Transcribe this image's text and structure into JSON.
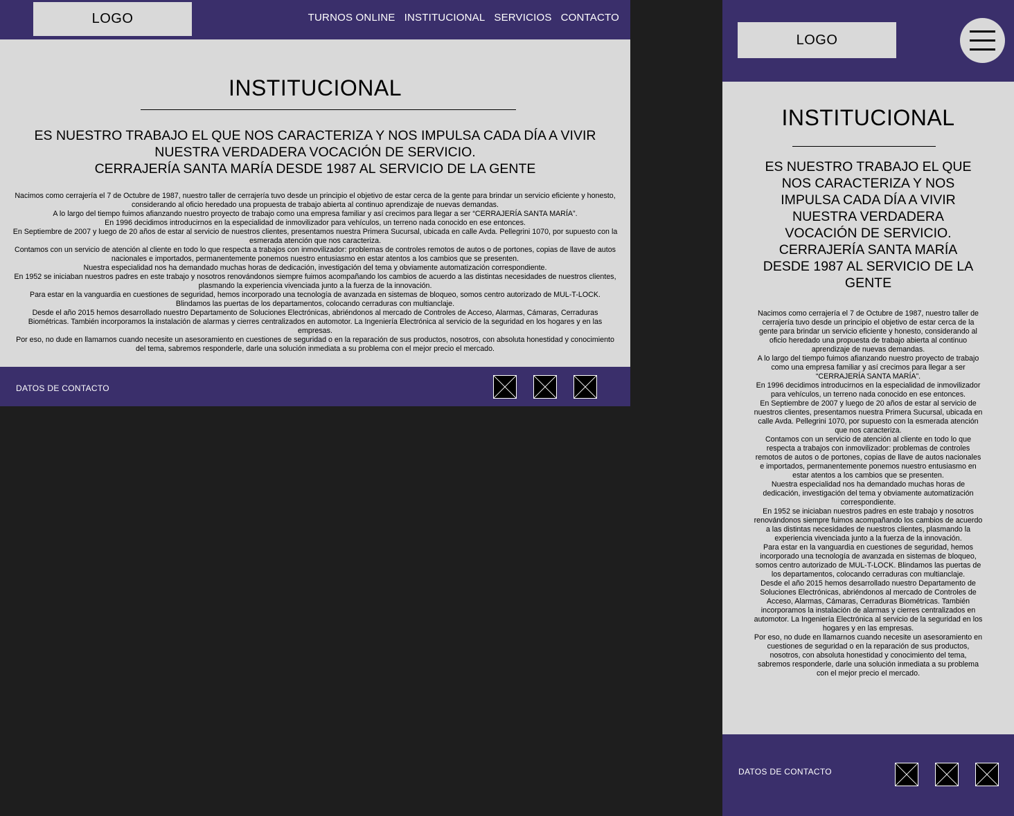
{
  "colors": {
    "header_bg": "#3a2f6b",
    "content_bg": "#d9d9d9",
    "canvas_bg": "#1e1e1e",
    "text": "#000000",
    "footer_text": "#ffffff"
  },
  "header": {
    "logo": "LOGO",
    "nav": [
      "TURNOS ONLINE",
      "INSTITUCIONAL",
      "SERVICIOS",
      "CONTACTO"
    ]
  },
  "mobile_header": {
    "logo": "LOGO",
    "menu_icon": "hamburger-icon"
  },
  "main": {
    "title": "INSTITUCIONAL",
    "subtitle": [
      "ES NUESTRO TRABAJO EL QUE NOS CARACTERIZA Y NOS IMPULSA CADA DÍA A VIVIR NUESTRA VERDADERA VOCACIÓN DE SERVICIO.",
      "CERRAJERÍA SANTA MARÍA DESDE 1987 AL SERVICIO DE LA GENTE"
    ],
    "paragraphs": [
      "Nacimos como cerrajería el 7 de Octubre de 1987, nuestro taller de cerrajería tuvo desde un principio el objetivo de estar cerca de la gente para brindar un servicio eficiente y honesto, considerando al oficio heredado una propuesta de trabajo abierta al continuo aprendizaje de nuevas demandas.",
      "A lo largo del tiempo fuimos afianzando nuestro proyecto de trabajo como una empresa familiar y así crecimos para llegar a ser “CERRAJERÍA SANTA MARÍA”.",
      "En 1996 decidimos introducirnos en la especialidad de inmovilizador para vehículos, un terreno nada conocido en ese entonces.",
      "En Septiembre de 2007 y luego de 20 años de estar al servicio de nuestros clientes, presentamos nuestra Primera Sucursal, ubicada en calle Avda. Pellegrini 1070, por supuesto con la esmerada atención que nos caracteriza.",
      "Contamos con un servicio de atención al cliente en todo lo que respecta a trabajos con inmovilizador: problemas de controles remotos de autos o de portones, copias de llave de autos nacionales e importados, permanentemente ponemos nuestro entusiasmo en estar atentos a los cambios que se presenten.",
      "Nuestra especialidad nos ha demandado muchas horas de dedicación, investigación del tema y obviamente automatización correspondiente.",
      "En 1952 se iniciaban nuestros padres en este trabajo y nosotros renovándonos siempre fuimos acompañando los cambios de acuerdo a las distintas necesidades de nuestros clientes, plasmando la experiencia vivenciada junto a la fuerza de la innovación.",
      "Para estar en la vanguardia en cuestiones de seguridad, hemos incorporado una tecnología de avanzada en sistemas de bloqueo, somos centro autorizado de MUL-T-LOCK. Blindamos las puertas de los departamentos, colocando cerraduras con multianclaje.",
      "Desde el año 2015 hemos desarrollado nuestro Departamento de Soluciones Electrónicas, abriéndonos al mercado de Controles de Acceso, Alarmas, Cámaras, Cerraduras Biométricas. También incorporamos la instalación de alarmas y cierres centralizados en automotor. La Ingeniería Electrónica al servicio de la seguridad en los hogares y en las empresas.",
      "Por eso, no dude en llamarnos cuando necesite un asesoramiento en cuestiones de seguridad o en la reparación de sus productos, nosotros, con absoluta honestidad y conocimiento del tema, sabremos responderle, darle una solución inmediata a su problema con el mejor precio el mercado."
    ]
  },
  "footer": {
    "contact_label": "DATOS DE CONTACTO",
    "social_icons": [
      "image-placeholder-icon",
      "image-placeholder-icon",
      "image-placeholder-icon"
    ]
  }
}
